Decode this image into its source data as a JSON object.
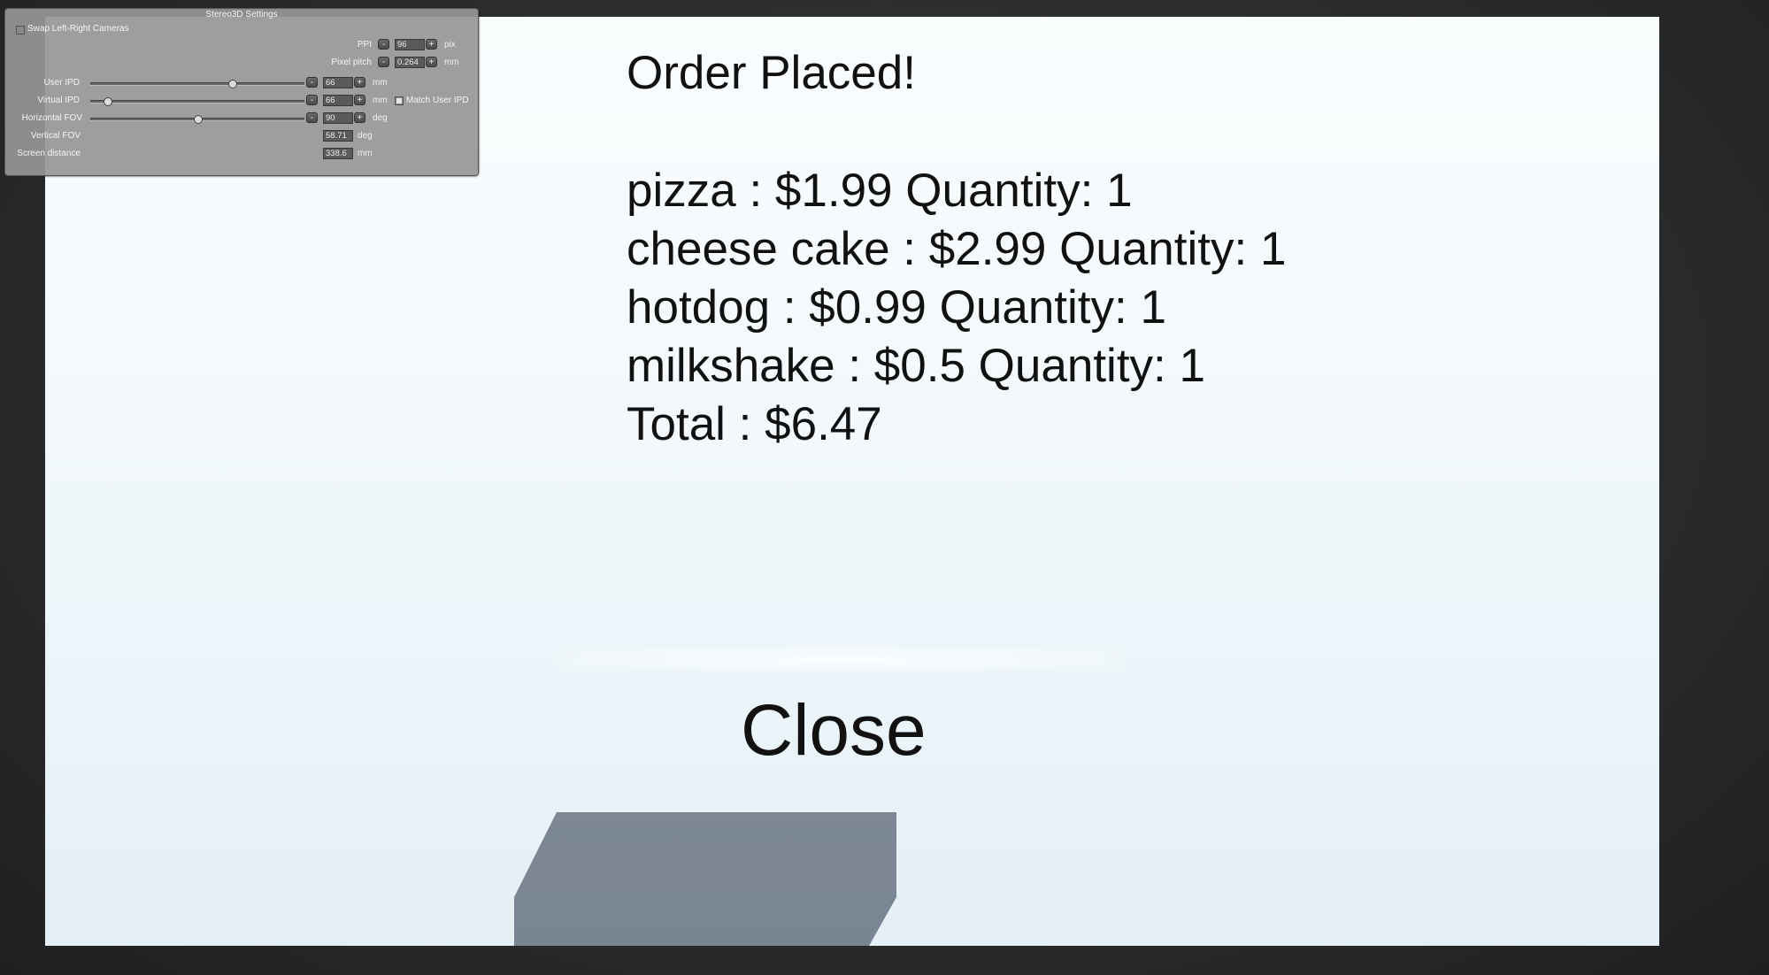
{
  "order": {
    "title": "Order Placed!",
    "items": [
      {
        "text": "pizza : $1.99 Quantity: 1"
      },
      {
        "text": "cheese cake : $2.99 Quantity: 1"
      },
      {
        "text": "hotdog : $0.99 Quantity: 1"
      },
      {
        "text": "milkshake : $0.5 Quantity: 1"
      }
    ],
    "total": "Total : $6.47",
    "close_label": "Close"
  },
  "stereo": {
    "title": "Stereo3D Settings",
    "swap_label": "Swap Left-Right Cameras",
    "minus": "-",
    "plus": "+",
    "ppi": {
      "label": "PPI",
      "value": "96",
      "unit": "pix"
    },
    "pixel_pitch": {
      "label": "Pixel pitch",
      "value": "0.264",
      "unit": "mm"
    },
    "user_ipd": {
      "label": "User IPD",
      "value": "66",
      "unit": "mm",
      "level": 0.66
    },
    "virtual_ipd": {
      "label": "Virtual IPD",
      "value": "66",
      "unit": "mm",
      "level": 0.08,
      "match_label": "Match User IPD"
    },
    "horizontal_fov": {
      "label": "Horizontal FOV",
      "value": "90",
      "unit": "deg",
      "level": 0.5
    },
    "vertical_fov": {
      "label": "Vertical FOV",
      "value": "58.71",
      "unit": "deg"
    },
    "screen_distance": {
      "label": "Screen distance",
      "value": "338.6",
      "unit": "mm"
    }
  },
  "colors": {
    "viewport_bg": "#f2f8fb",
    "panel_bg": "#969696",
    "floor_block": "#7b8695"
  }
}
